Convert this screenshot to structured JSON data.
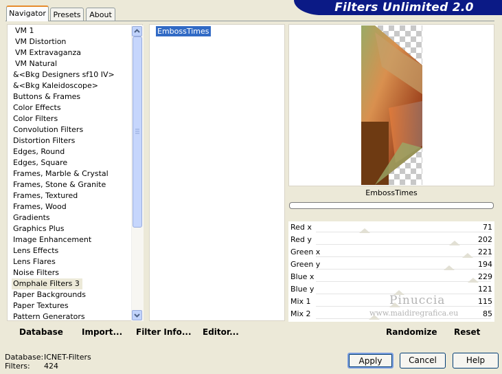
{
  "header": {
    "title": "Filters Unlimited 2.0"
  },
  "tabs": [
    {
      "label": "Navigator",
      "active": true
    },
    {
      "label": "Presets",
      "active": false
    },
    {
      "label": "About",
      "active": false
    }
  ],
  "categories": [
    "VM 1",
    "VM Distortion",
    "VM Extravaganza",
    "VM Natural",
    "&<Bkg Designers sf10 IV>",
    "&<Bkg Kaleidoscope>",
    "Buttons & Frames",
    "Color Effects",
    "Color Filters",
    "Convolution Filters",
    "Distortion Filters",
    "Edges, Round",
    "Edges, Square",
    "Frames, Marble & Crystal",
    "Frames, Stone & Granite",
    "Frames, Textured",
    "Frames, Wood",
    "Gradients",
    "Graphics Plus",
    "Image Enhancement",
    "Lens Effects",
    "Lens Flares",
    "Noise Filters",
    "Omphale Filters 3",
    "Paper Backgrounds",
    "Paper Textures",
    "Pattern Generators"
  ],
  "selected_category": "Omphale Filters 3",
  "filters": [
    "EmbossTimes"
  ],
  "selected_filter": "EmbossTimes",
  "preview": {
    "label": "EmbossTimes"
  },
  "sliders": [
    {
      "name": "Red x",
      "value": 71
    },
    {
      "name": "Red y",
      "value": 202
    },
    {
      "name": "Green x",
      "value": 221
    },
    {
      "name": "Green y",
      "value": 194
    },
    {
      "name": "Blue x",
      "value": 229
    },
    {
      "name": "Blue y",
      "value": 121
    },
    {
      "name": "Mix 1",
      "value": 115
    },
    {
      "name": "Mix 2",
      "value": 85
    }
  ],
  "slider_max": 255,
  "watermark": {
    "line1": "Pinuccia",
    "line2": "www.maidiregrafica.eu"
  },
  "left_buttons": {
    "database": "Database",
    "import": "Import...",
    "filter_info": "Filter Info...",
    "editor": "Editor..."
  },
  "right_buttons": {
    "randomize": "Randomize",
    "reset": "Reset"
  },
  "status": {
    "database_label": "Database:",
    "database_value": "ICNET-Filters",
    "filters_label": "Filters:",
    "filters_value": "424"
  },
  "dialog_buttons": {
    "apply": "Apply",
    "cancel": "Cancel",
    "help": "Help"
  },
  "colors": {
    "banner": "#0b1a86",
    "selection": "#316ac5",
    "tab_accent": "#e68b2c"
  }
}
